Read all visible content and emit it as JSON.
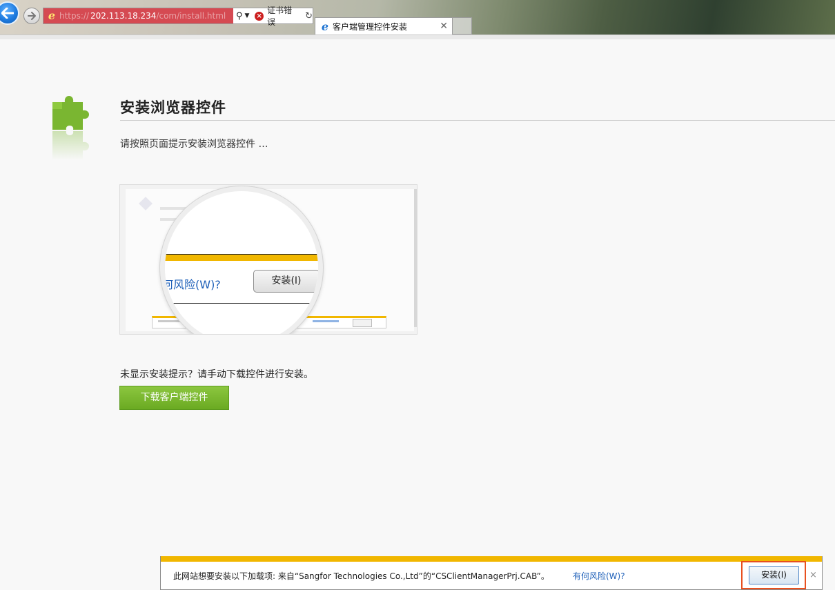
{
  "browser": {
    "url": {
      "protocol": "https://",
      "host": "202.113.18.234",
      "path": "/com/install.html"
    },
    "cert_error_label": "证书错误",
    "tab": {
      "title": "客户端管理控件安装"
    },
    "icons": {
      "back": "back-arrow-icon",
      "forward": "forward-arrow-icon",
      "search": "search-icon",
      "refresh": "refresh-icon",
      "close": "close-icon"
    }
  },
  "page": {
    "title": "安装浏览器控件",
    "subtitle": "请按照页面提示安装浏览器控件 …",
    "illustration": {
      "link_text": "何风险(W)?",
      "button_label": "安装(I)"
    },
    "hint": "未显示安装提示？请手动下载控件进行安装。",
    "download_button": "下载客户端控件",
    "accent_color": "#7ab631"
  },
  "infobar": {
    "message": "此网站想要安装以下加载项: 来自“Sangfor Technologies Co.,Ltd”的“CSClientManagerPrj.CAB”。",
    "risk_link": "有何风险(W)?",
    "install_button": "安装(I)",
    "close_symbol": "×",
    "bar_color": "#f1b700",
    "highlight_color": "#e8501f"
  }
}
